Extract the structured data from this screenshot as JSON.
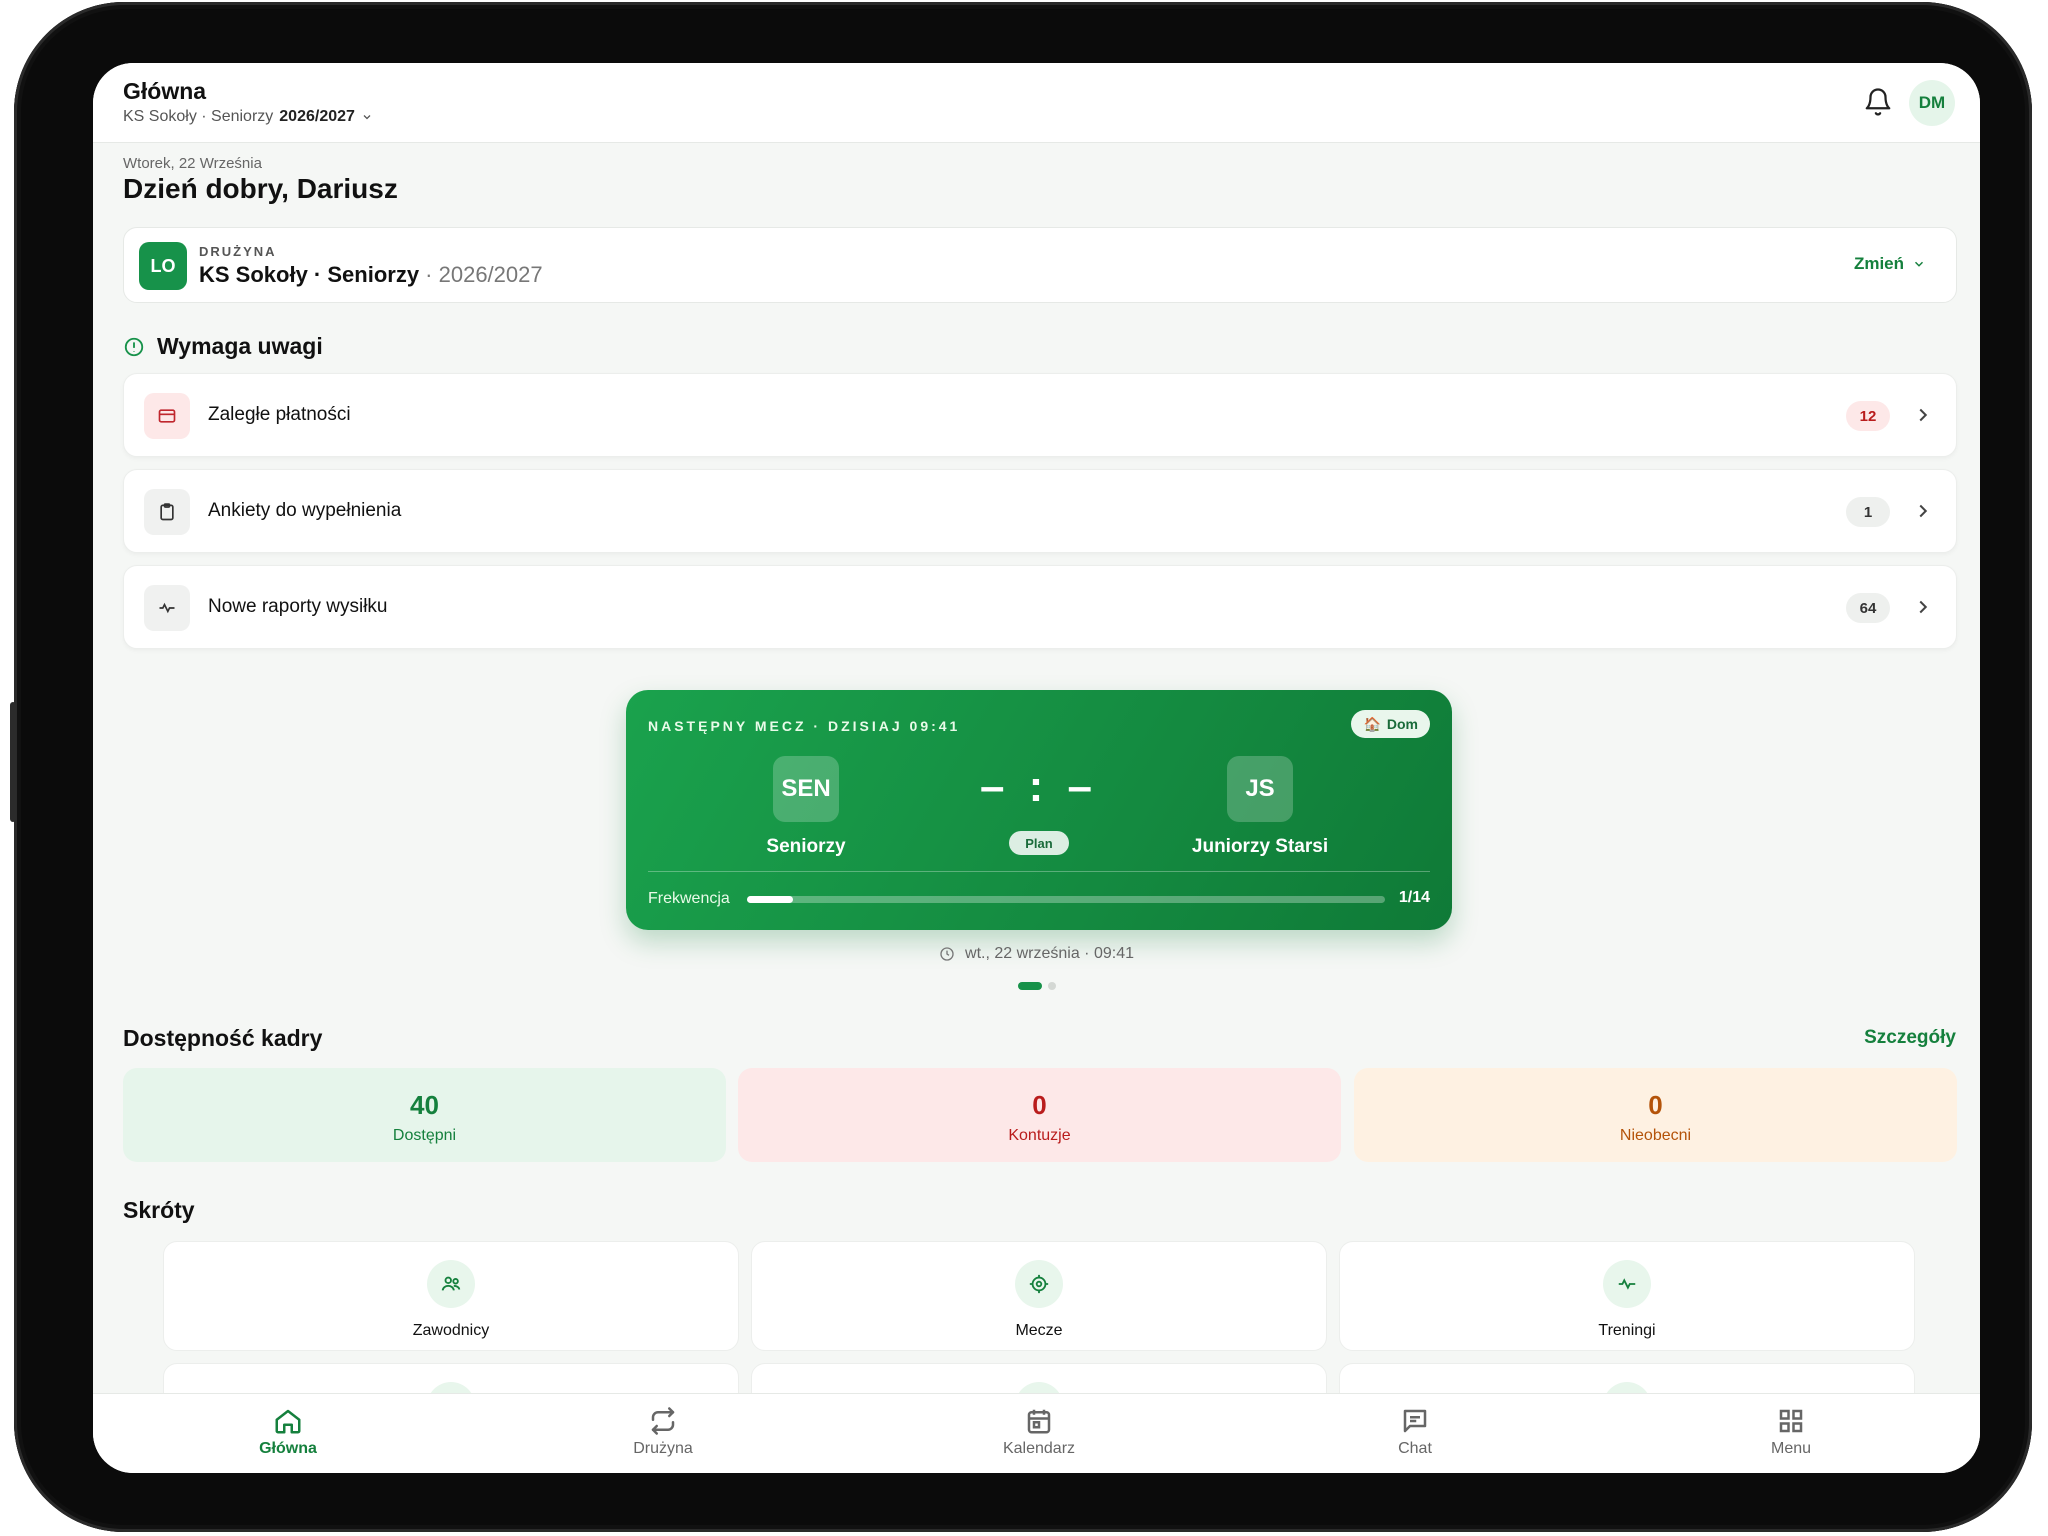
{
  "header": {
    "title": "Główna",
    "club": "KS Sokoły · Seniorzy",
    "season": "2026/2027",
    "avatar": "DM"
  },
  "greeting": {
    "date": "Wtorek, 22 Września",
    "text": "Dzień dobry, Dariusz"
  },
  "team_card": {
    "logo": "LO",
    "label": "DRUŻYNA",
    "name": "KS Sokoły · Seniorzy",
    "season": " · 2026/2027",
    "change_label": "Zmień"
  },
  "attention": {
    "title": "Wymaga uwagi",
    "items": [
      {
        "label": "Zaległe płatności",
        "count": "12",
        "icon": "credit-card-icon"
      },
      {
        "label": "Ankiety do wypełnienia",
        "count": "1",
        "icon": "clipboard-icon"
      },
      {
        "label": "Nowe raporty wysiłku",
        "count": "64",
        "icon": "activity-icon"
      }
    ]
  },
  "next_match": {
    "label": "NASTĘPNY MECZ · DZISIAJ 09:41",
    "venue": "Dom",
    "home": {
      "short": "SEN",
      "name": "Seniorzy"
    },
    "away": {
      "short": "JS",
      "name": "Juniorzy Starsi"
    },
    "score": "– : –",
    "status": "Plan",
    "attendance_label": "Frekwencja",
    "attendance_value": "1/14",
    "attendance_fraction": 0.0714,
    "time": "wt., 22 września · 09:41",
    "carousel_pages": 2,
    "carousel_active": 1
  },
  "availability": {
    "title": "Dostępność kadry",
    "details_label": "Szczegóły",
    "stats": [
      {
        "value": "40",
        "label": "Dostępni",
        "color": "#15803d"
      },
      {
        "value": "0",
        "label": "Kontuzje",
        "color": "#b91c1c"
      },
      {
        "value": "0",
        "label": "Nieobecni",
        "color": "#b45309"
      }
    ]
  },
  "shortcuts": {
    "title": "Skróty",
    "items": [
      {
        "label": "Zawodnicy",
        "icon": "users-icon"
      },
      {
        "label": "Mecze",
        "icon": "target-icon"
      },
      {
        "label": "Treningi",
        "icon": "activity-icon"
      }
    ]
  },
  "tabbar": {
    "items": [
      {
        "label": "Główna",
        "icon": "home-icon",
        "active": true
      },
      {
        "label": "Drużyna",
        "icon": "repeat-icon"
      },
      {
        "label": "Kalendarz",
        "icon": "calendar-icon"
      },
      {
        "label": "Chat",
        "icon": "chat-icon"
      },
      {
        "label": "Menu",
        "icon": "grid-icon"
      }
    ]
  },
  "colors": {
    "accent": "#15803d",
    "accent_light": "#e8f6ec",
    "danger_bg": "#fde8e8",
    "warn_bg": "#fef1e2",
    "ok_bg": "#e6f5eb"
  }
}
